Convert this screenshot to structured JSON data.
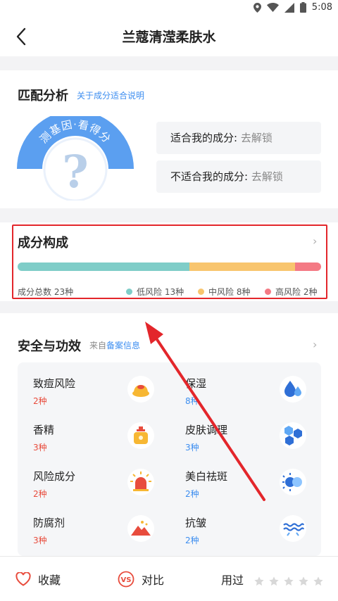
{
  "status_bar": {
    "time": "5:08"
  },
  "header": {
    "title": "兰蔻清滢柔肤水"
  },
  "match": {
    "title": "匹配分析",
    "link": "关于成分适合说明",
    "gauge_text": "测基因·看得分",
    "gauge_symbol": "?",
    "suitable_label": "适合我的成分:",
    "suitable_value": "去解锁",
    "unsuitable_label": "不适合我的成分:",
    "unsuitable_value": "去解锁"
  },
  "composition": {
    "title": "成分构成",
    "chevron": "›",
    "total": "成分总数 23种",
    "legend": [
      {
        "label": "低风险 13种",
        "color": "#7fcdc8",
        "count": 13
      },
      {
        "label": "中风险 8种",
        "color": "#f8c56e",
        "count": 8
      },
      {
        "label": "高风险 2种",
        "color": "#f47a84",
        "count": 2
      }
    ]
  },
  "safety": {
    "title": "安全与功效",
    "source_prefix": "来自",
    "source_link": "备案信息",
    "chevron": "›",
    "items": [
      {
        "name": "致痘风险",
        "count": "2种",
        "icon": "acne-icon",
        "color": "#e84c3d"
      },
      {
        "name": "保湿",
        "count": "8种",
        "icon": "water-drop-icon",
        "color": "#3d8ef0"
      },
      {
        "name": "香精",
        "count": "3种",
        "icon": "perfume-icon",
        "color": "#e84c3d"
      },
      {
        "name": "皮肤调理",
        "count": "3种",
        "icon": "hexagon-cells-icon",
        "color": "#3d8ef0"
      },
      {
        "name": "风险成分",
        "count": "2种",
        "icon": "alarm-light-icon",
        "color": "#e84c3d"
      },
      {
        "name": "美白祛斑",
        "count": "2种",
        "icon": "sun-icon",
        "color": "#3d8ef0"
      },
      {
        "name": "防腐剂",
        "count": "3种",
        "icon": "preservative-icon",
        "color": "#e84c3d"
      },
      {
        "name": "抗皱",
        "count": "2种",
        "icon": "wave-icon",
        "color": "#3d8ef0"
      }
    ]
  },
  "bottom": {
    "favorite": "收藏",
    "compare": "对比",
    "compare_badge": "VS",
    "used": "用过",
    "rating": 0
  },
  "colors": {
    "accent": "#3d8ef0",
    "risk": "#e84c3d",
    "annotation": "#e3262b"
  }
}
